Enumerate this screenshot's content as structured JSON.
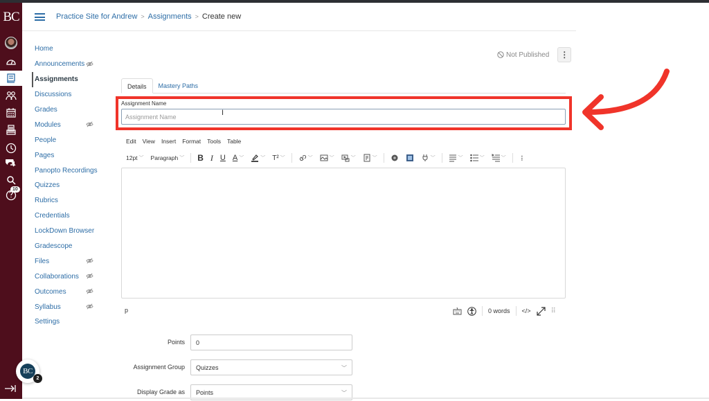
{
  "global_nav": {
    "logo": "BC",
    "items": [
      {
        "name": "account",
        "icon": "avatar-icon"
      },
      {
        "name": "dashboard",
        "icon": "dashboard-icon"
      },
      {
        "name": "courses",
        "icon": "courses-icon",
        "active": true
      },
      {
        "name": "groups",
        "icon": "groups-icon"
      },
      {
        "name": "calendar",
        "icon": "calendar-icon"
      },
      {
        "name": "inbox",
        "icon": "inbox-icon"
      },
      {
        "name": "history",
        "icon": "clock-icon"
      },
      {
        "name": "commons",
        "icon": "commons-icon"
      },
      {
        "name": "studio",
        "icon": "studio-icon"
      },
      {
        "name": "help",
        "icon": "help-icon",
        "badge": "10"
      }
    ],
    "collapse_icon": "collapse-icon"
  },
  "breadcrumb": {
    "items": [
      "Practice Site for Andrew",
      "Assignments",
      "Create new"
    ]
  },
  "course_nav": {
    "items": [
      {
        "label": "Home",
        "hidden": false
      },
      {
        "label": "Announcements",
        "hidden": true
      },
      {
        "label": "Assignments",
        "hidden": false,
        "active": true
      },
      {
        "label": "Discussions",
        "hidden": false
      },
      {
        "label": "Grades",
        "hidden": false
      },
      {
        "label": "Modules",
        "hidden": true
      },
      {
        "label": "People",
        "hidden": false
      },
      {
        "label": "Pages",
        "hidden": false
      },
      {
        "label": "Panopto Recordings",
        "hidden": false
      },
      {
        "label": "Quizzes",
        "hidden": false
      },
      {
        "label": "Rubrics",
        "hidden": false
      },
      {
        "label": "Credentials",
        "hidden": false
      },
      {
        "label": "LockDown Browser",
        "hidden": false
      },
      {
        "label": "Gradescope",
        "hidden": false
      },
      {
        "label": "Files",
        "hidden": true
      },
      {
        "label": "Collaborations",
        "hidden": true
      },
      {
        "label": "Outcomes",
        "hidden": true
      },
      {
        "label": "Syllabus",
        "hidden": true
      },
      {
        "label": "Settings",
        "hidden": false
      }
    ]
  },
  "status": {
    "publish_label": "Not Published",
    "more_label": "⋮"
  },
  "tabs": [
    {
      "label": "Details",
      "active": true
    },
    {
      "label": "Mastery Paths",
      "active": false
    }
  ],
  "assignment_name": {
    "label": "Assignment Name",
    "placeholder": "Assignment Name",
    "value": ""
  },
  "editor": {
    "menu": [
      "Edit",
      "View",
      "Insert",
      "Format",
      "Tools",
      "Table"
    ],
    "font_size": "12pt",
    "block_format": "Paragraph",
    "path": "p",
    "word_count": "0 words",
    "html_toggle": "</>"
  },
  "form": {
    "points": {
      "label": "Points",
      "value": "0"
    },
    "assignment_group": {
      "label": "Assignment Group",
      "value": "Quizzes"
    },
    "display_grade_as": {
      "label": "Display Grade as",
      "value": "Points"
    }
  },
  "fab": {
    "label": "BC",
    "count": "2"
  },
  "annotation": {
    "color": "#f0342a"
  },
  "colors": {
    "nav_bg": "#4e0e1c",
    "link": "#2d6da6"
  }
}
